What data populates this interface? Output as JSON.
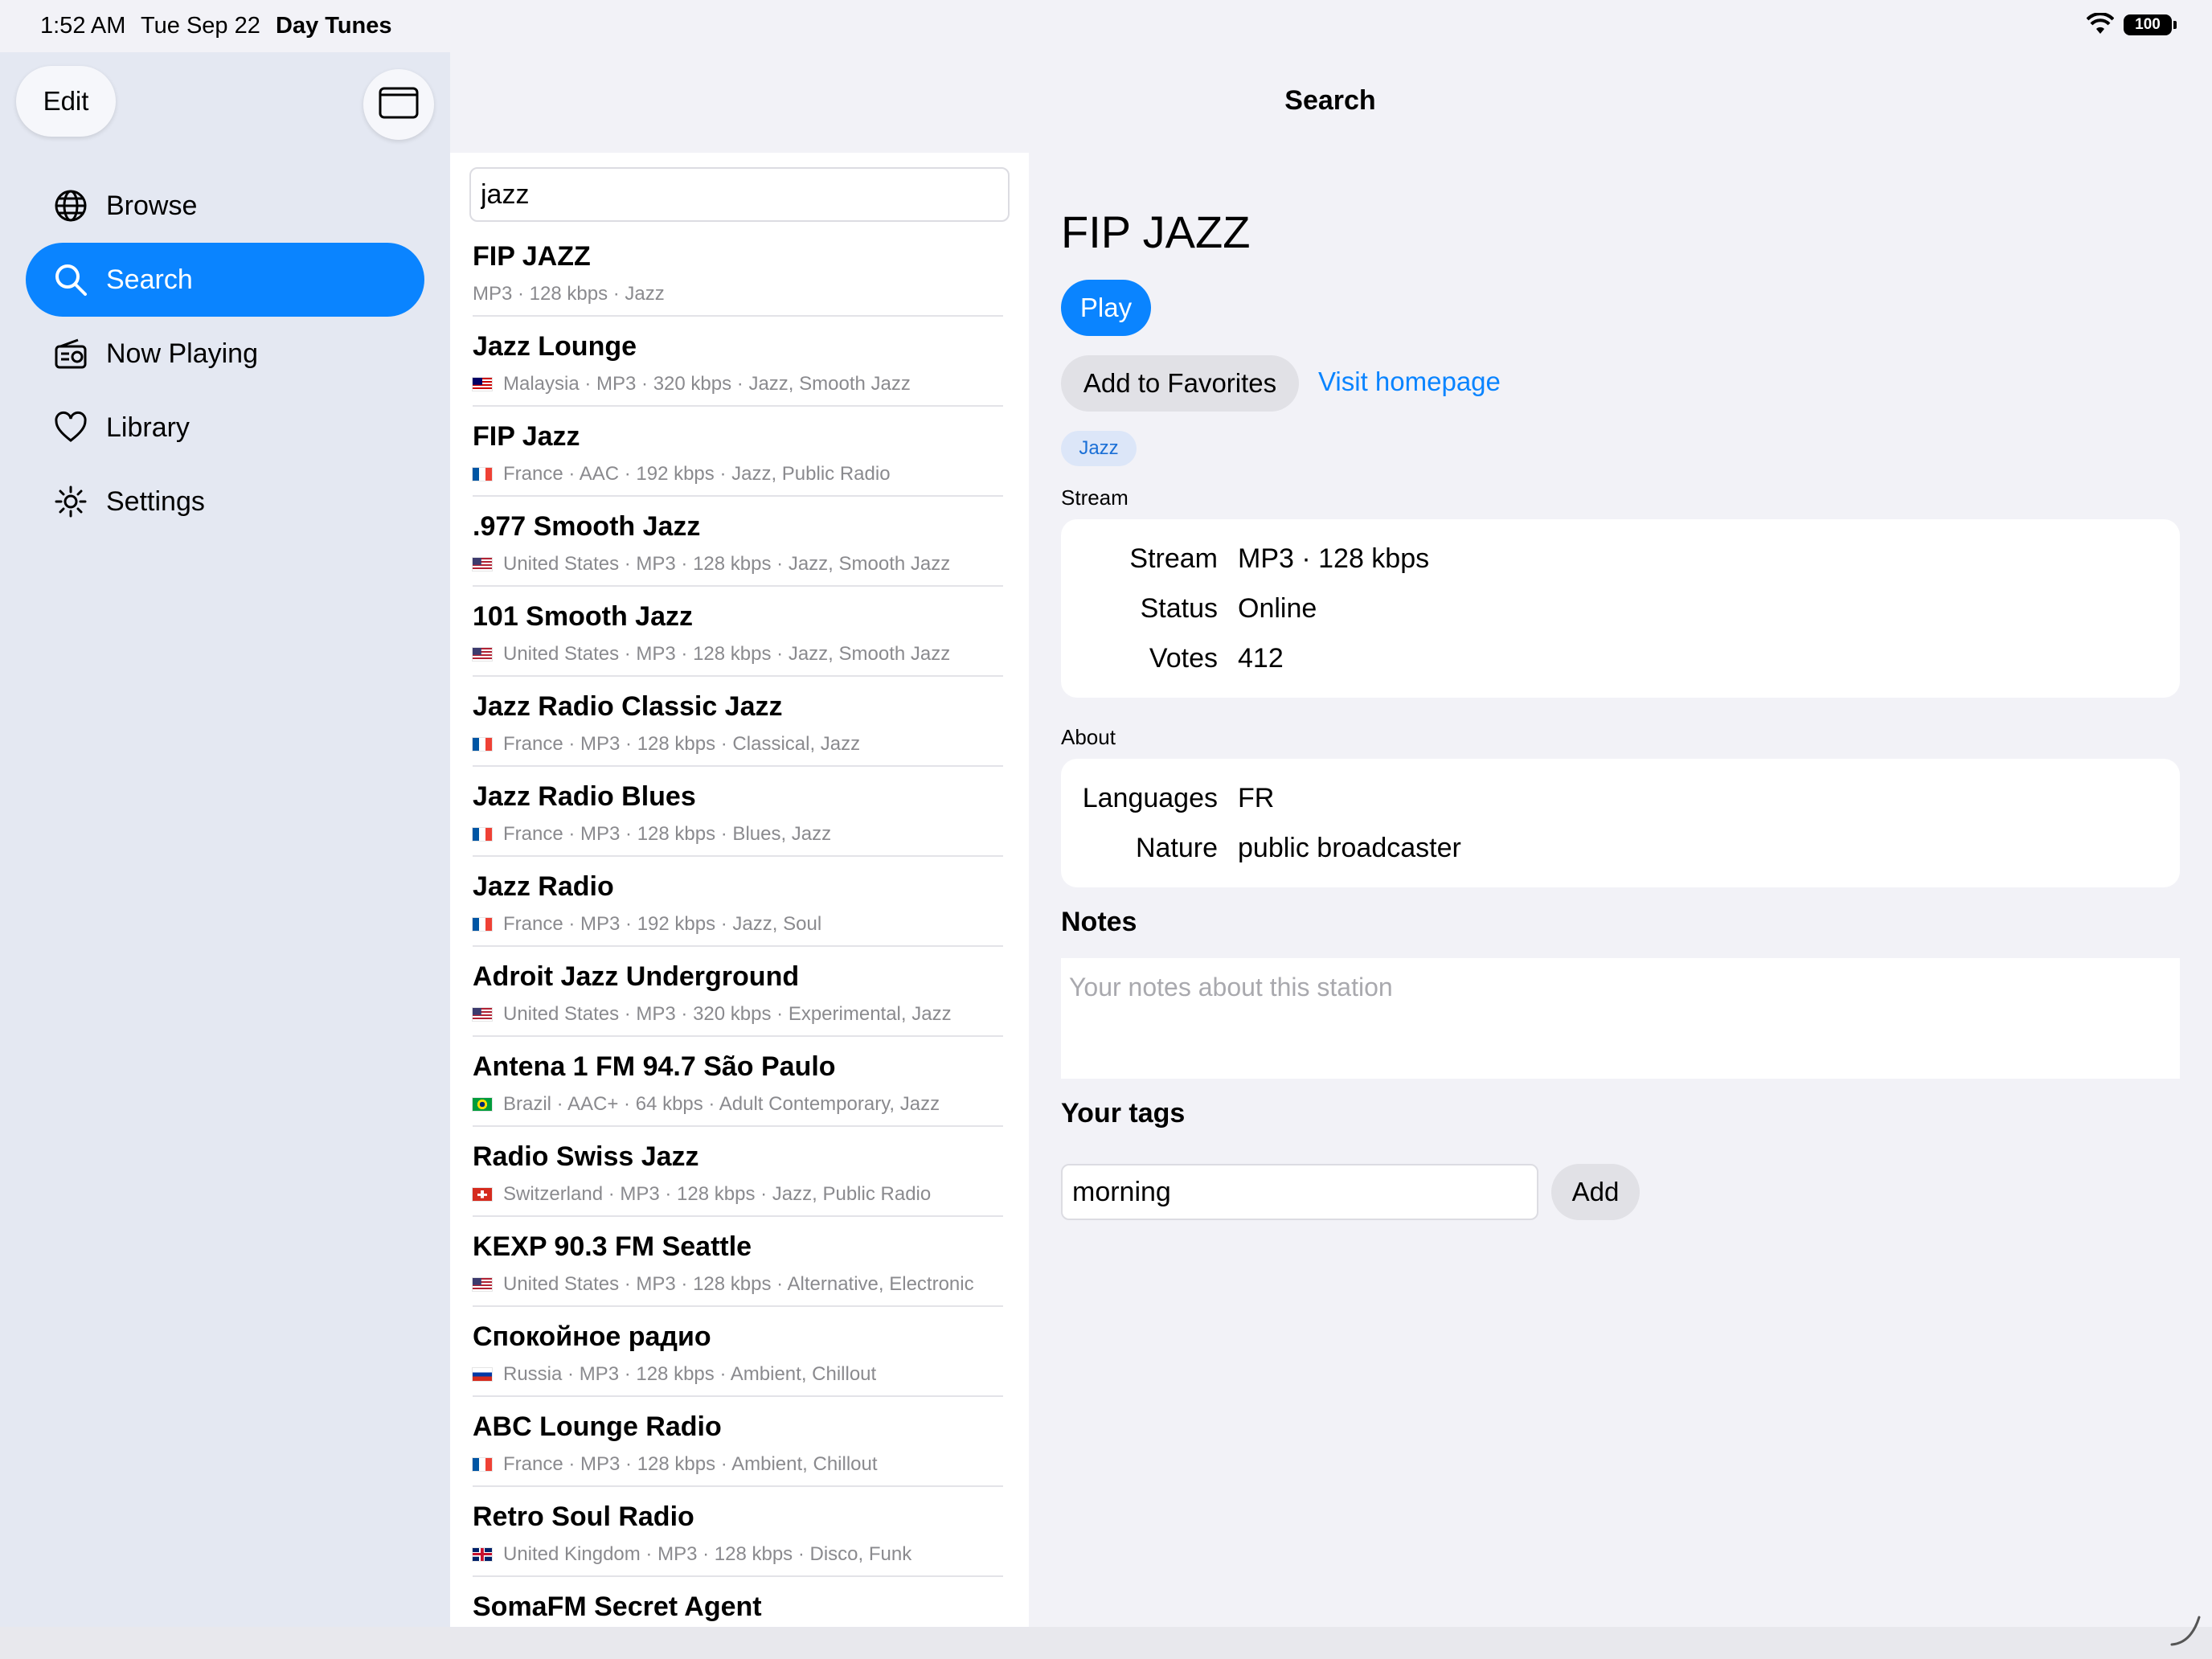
{
  "status_bar": {
    "time": "1:52 AM",
    "date": "Tue Sep 22",
    "app": "Day Tunes",
    "battery": "100"
  },
  "sidebar": {
    "edit_label": "Edit",
    "items": [
      {
        "label": "Browse",
        "icon": "globe-icon",
        "active": false
      },
      {
        "label": "Search",
        "icon": "search-icon",
        "active": true
      },
      {
        "label": "Now Playing",
        "icon": "radio-icon",
        "active": false
      },
      {
        "label": "Library",
        "icon": "heart-icon",
        "active": false
      },
      {
        "label": "Settings",
        "icon": "gear-icon",
        "active": false
      }
    ]
  },
  "header": {
    "title": "Search"
  },
  "search": {
    "value": "jazz"
  },
  "results": [
    {
      "title": "FIP JAZZ",
      "flag": "",
      "subtitle": "MP3 · 128 kbps · Jazz"
    },
    {
      "title": "Jazz Lounge",
      "flag": "my",
      "subtitle": "Malaysia · MP3 · 320 kbps · Jazz, Smooth Jazz"
    },
    {
      "title": "FIP Jazz",
      "flag": "fr",
      "subtitle": "France · AAC · 192 kbps · Jazz, Public Radio"
    },
    {
      "title": ".977 Smooth Jazz",
      "flag": "us",
      "subtitle": "United States · MP3 · 128 kbps · Jazz, Smooth Jazz"
    },
    {
      "title": "101 Smooth Jazz",
      "flag": "us",
      "subtitle": "United States · MP3 · 128 kbps · Jazz, Smooth Jazz"
    },
    {
      "title": "Jazz Radio Classic Jazz",
      "flag": "fr",
      "subtitle": "France · MP3 · 128 kbps · Classical, Jazz"
    },
    {
      "title": "Jazz Radio Blues",
      "flag": "fr",
      "subtitle": "France · MP3 · 128 kbps · Blues, Jazz"
    },
    {
      "title": "Jazz Radio",
      "flag": "fr",
      "subtitle": "France · MP3 · 192 kbps · Jazz, Soul"
    },
    {
      "title": "Adroit Jazz Underground",
      "flag": "us",
      "subtitle": "United States · MP3 · 320 kbps · Experimental, Jazz"
    },
    {
      "title": "Antena 1 FM 94.7 São Paulo",
      "flag": "br",
      "subtitle": "Brazil · AAC+ · 64 kbps · Adult Contemporary, Jazz"
    },
    {
      "title": "Radio Swiss Jazz",
      "flag": "ch",
      "subtitle": "Switzerland · MP3 · 128 kbps · Jazz, Public Radio"
    },
    {
      "title": "KEXP 90.3 FM Seattle",
      "flag": "us",
      "subtitle": "United States · MP3 · 128 kbps · Alternative, Electronic"
    },
    {
      "title": "Спокойное радио",
      "flag": "ru",
      "subtitle": "Russia · MP3 · 128 kbps · Ambient, Chillout"
    },
    {
      "title": "ABC Lounge Radio",
      "flag": "fr",
      "subtitle": "France · MP3 · 128 kbps · Ambient, Chillout"
    },
    {
      "title": "Retro Soul Radio",
      "flag": "gb",
      "subtitle": "United Kingdom · MP3 · 128 kbps · Disco, Funk"
    },
    {
      "title": "SomaFM Secret Agent",
      "flag": "",
      "subtitle": ""
    }
  ],
  "detail": {
    "name": "FIP JAZZ",
    "play_label": "Play",
    "favorites_label": "Add to Favorites",
    "homepage_label": "Visit homepage",
    "tag": "Jazz",
    "stream_section": "Stream",
    "stream_rows": [
      {
        "label": "Stream",
        "value": "MP3 · 128 kbps"
      },
      {
        "label": "Status",
        "value": "Online"
      },
      {
        "label": "Votes",
        "value": "412"
      }
    ],
    "about_section": "About",
    "about_rows": [
      {
        "label": "Languages",
        "value": "FR"
      },
      {
        "label": "Nature",
        "value": "public broadcaster"
      }
    ],
    "notes_title": "Notes",
    "notes_placeholder": "Your notes about this station",
    "tags_title": "Your tags",
    "tag_input_value": "morning",
    "add_label": "Add"
  },
  "colors": {
    "accent": "#0a84ff",
    "sidebar_bg": "#e4e8f2",
    "page_bg": "#f2f2f7"
  }
}
